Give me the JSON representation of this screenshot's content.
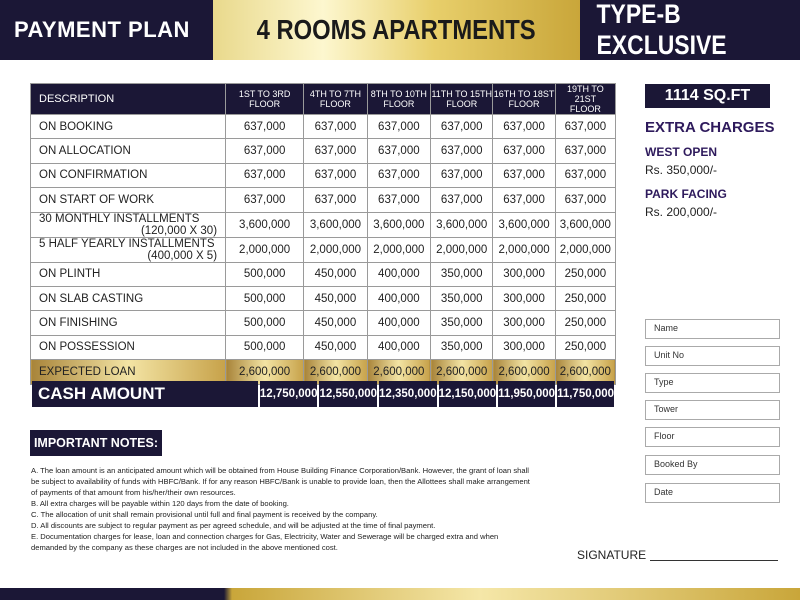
{
  "header": {
    "left_title": "PAYMENT PLAN",
    "center_title": "4 ROOMS APARTMENTS",
    "right_title": "TYPE-B EXCLUSIVE"
  },
  "table": {
    "columns": [
      "DESCRIPTION",
      "1ST TO 3RD FLOOR",
      "4TH TO 7TH FLOOR",
      "8TH TO 10TH FLOOR",
      "11TH TO 15TH FLOOR",
      "16TH TO 18ST FLOOR",
      "19TH TO 21ST FLOOR"
    ],
    "column_lines": [
      [
        "1ST TO 3RD",
        "FLOOR"
      ],
      [
        "4TH TO 7TH",
        "FLOOR"
      ],
      [
        "8TH TO 10TH",
        "FLOOR"
      ],
      [
        "11TH TO 15TH",
        "FLOOR"
      ],
      [
        "16TH TO 18ST",
        "FLOOR"
      ],
      [
        "19TH TO 21ST",
        "FLOOR"
      ]
    ],
    "rows": [
      {
        "label": "ON BOOKING",
        "sub": "",
        "values": [
          "637,000",
          "637,000",
          "637,000",
          "637,000",
          "637,000",
          "637,000"
        ]
      },
      {
        "label": "ON ALLOCATION",
        "sub": "",
        "values": [
          "637,000",
          "637,000",
          "637,000",
          "637,000",
          "637,000",
          "637,000"
        ]
      },
      {
        "label": "ON CONFIRMATION",
        "sub": "",
        "values": [
          "637,000",
          "637,000",
          "637,000",
          "637,000",
          "637,000",
          "637,000"
        ]
      },
      {
        "label": "ON START OF WORK",
        "sub": "",
        "values": [
          "637,000",
          "637,000",
          "637,000",
          "637,000",
          "637,000",
          "637,000"
        ]
      },
      {
        "label": "30 MONTHLY INSTALLMENTS",
        "sub": "(120,000 X 30)",
        "values": [
          "3,600,000",
          "3,600,000",
          "3,600,000",
          "3,600,000",
          "3,600,000",
          "3,600,000"
        ]
      },
      {
        "label": "5 HALF YEARLY INSTALLMENTS",
        "sub": "(400,000 X 5)",
        "values": [
          "2,000,000",
          "2,000,000",
          "2,000,000",
          "2,000,000",
          "2,000,000",
          "2,000,000"
        ]
      },
      {
        "label": "ON PLINTH",
        "sub": "",
        "values": [
          "500,000",
          "450,000",
          "400,000",
          "350,000",
          "300,000",
          "250,000"
        ]
      },
      {
        "label": "ON SLAB CASTING",
        "sub": "",
        "values": [
          "500,000",
          "450,000",
          "400,000",
          "350,000",
          "300,000",
          "250,000"
        ]
      },
      {
        "label": "ON FINISHING",
        "sub": "",
        "values": [
          "500,000",
          "450,000",
          "400,000",
          "350,000",
          "300,000",
          "250,000"
        ]
      },
      {
        "label": "ON POSSESSION",
        "sub": "",
        "values": [
          "500,000",
          "450,000",
          "400,000",
          "350,000",
          "300,000",
          "250,000"
        ]
      }
    ],
    "loan": {
      "label": "EXPECTED LOAN",
      "values": [
        "2,600,000",
        "2,600,000",
        "2,600,000",
        "2,600,000",
        "2,600,000",
        "2,600,000"
      ]
    },
    "cash": {
      "label": "CASH AMOUNT",
      "values": [
        "12,750,000",
        "12,550,000",
        "12,350,000",
        "12,150,000",
        "11,950,000",
        "11,750,000"
      ]
    }
  },
  "side": {
    "size_badge": "1114 SQ.FT",
    "extra_title": "EXTRA CHARGES",
    "west_label": "WEST OPEN",
    "west_value": "Rs. 350,000/-",
    "park_label": "PARK FACING",
    "park_value": "Rs. 200,000/-"
  },
  "form": {
    "fields": [
      "Name",
      "Unit No",
      "Type",
      "Tower",
      "Floor",
      "Booked By",
      "Date"
    ]
  },
  "notes": {
    "title": "IMPORTANT NOTES:",
    "items": [
      "A. The loan amount is an anticipated amount which will be obtained from House Building Finance Corporation/Bank. However, the grant of loan shall be subject to availability of funds with HBFC/Bank. If for any reason HBFC/Bank is unable to provide loan, then the Allottees shall make arrangement of payments of that amount from his/her/their own resources.",
      "B. All extra charges will be payable within 120 days from the date of booking.",
      "C. The allocation of unit shall remain provisional until full and final payment is received by the company.",
      "D. All discounts are subject to regular payment as per agreed schedule, and will be adjusted at the time of final payment.",
      "E. Documentation charges for lease, loan and connection charges for Gas, Electricity, Water and Sewerage will be charged extra and when demanded by the company as these charges are not included in the above mentioned cost."
    ]
  },
  "signature": {
    "label": "SIGNATURE"
  }
}
